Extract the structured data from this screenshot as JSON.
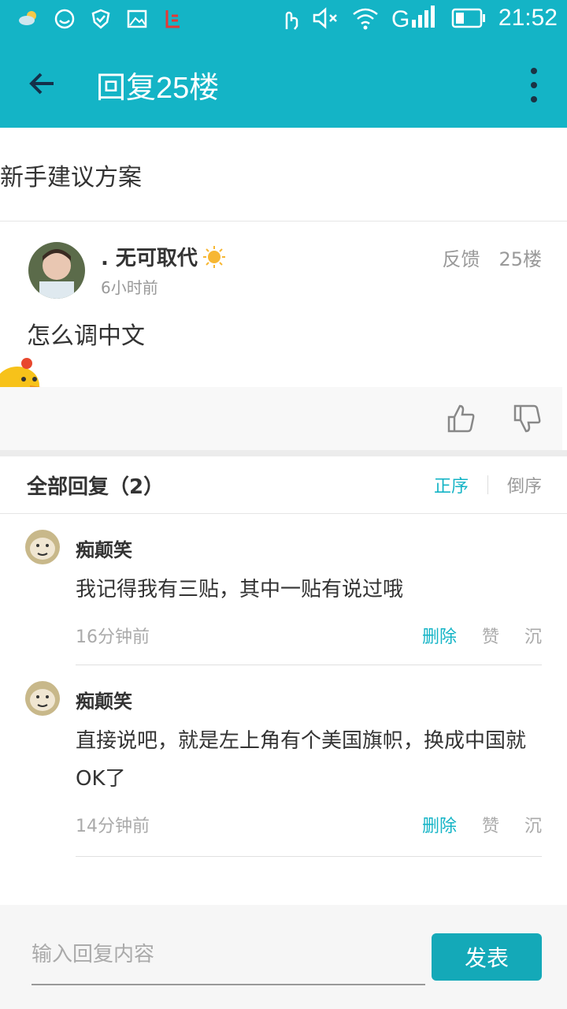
{
  "status_bar": {
    "time": "21:52",
    "icons": [
      "weather-icon",
      "smiley-icon",
      "shield-icon",
      "image-icon",
      "letv-icon",
      "touch-icon",
      "mute-icon",
      "wifi-icon",
      "signal-icon",
      "battery-icon"
    ]
  },
  "app_bar": {
    "title": "回复25楼",
    "back_icon": "arrow-left-icon",
    "menu_icon": "more-vert-icon"
  },
  "thread": {
    "title": "新手建议方案"
  },
  "post": {
    "username": ". 无可取代",
    "time": "6小时前",
    "feedback_label": "反馈",
    "floor": "25楼",
    "content": "怎么调中文"
  },
  "replies_header": {
    "label": "全部回复（2）",
    "sort_asc": "正序",
    "sort_desc": "倒序"
  },
  "replies": [
    {
      "username": "痴颠笑",
      "text": "我记得我有三贴，其中一贴有说过哦",
      "time": "16分钟前",
      "delete": "删除",
      "like": "赞",
      "sink": "沉"
    },
    {
      "username": "痴颠笑",
      "text": "直接说吧，就是左上角有个美国旗帜，换成中国就OK了",
      "time": "14分钟前",
      "delete": "删除",
      "like": "赞",
      "sink": "沉"
    }
  ],
  "reply_input": {
    "placeholder": "输入回复内容",
    "send_label": "发表"
  },
  "colors": {
    "accent": "#14b4c6",
    "send_button": "#14a9b8"
  }
}
